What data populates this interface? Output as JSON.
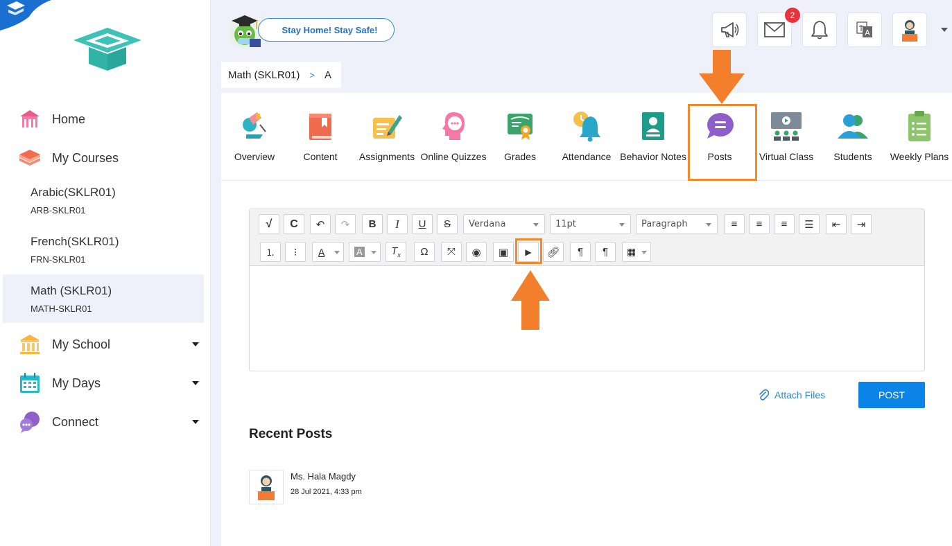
{
  "sidebar": {
    "nav": [
      {
        "label": "Home",
        "icon": "home-icon"
      },
      {
        "label": "My Courses",
        "icon": "courses-icon"
      }
    ],
    "courses": [
      {
        "title": "Arabic(SKLR01)",
        "code": "ARB-SKLR01"
      },
      {
        "title": "French(SKLR01)",
        "code": "FRN-SKLR01"
      },
      {
        "title": "Math (SKLR01)",
        "code": "MATH-SKLR01",
        "active": true
      }
    ],
    "sections": [
      {
        "label": "My School",
        "icon": "school-icon"
      },
      {
        "label": "My Days",
        "icon": "calendar-icon"
      },
      {
        "label": "Connect",
        "icon": "chat-icon"
      }
    ]
  },
  "header": {
    "banner": "Stay Home! Stay Safe!",
    "messages_badge": "2"
  },
  "breadcrumb": {
    "course": "Math (SKLR01)",
    "separator": ">",
    "section": "A"
  },
  "tabs": [
    {
      "label": "Overview",
      "icon": "overview-icon"
    },
    {
      "label": "Content",
      "icon": "book-icon"
    },
    {
      "label": "Assignments",
      "icon": "assignment-icon"
    },
    {
      "label": "Online Quizzes",
      "icon": "quiz-icon"
    },
    {
      "label": "Grades",
      "icon": "certificate-icon"
    },
    {
      "label": "Attendance",
      "icon": "bell-clock-icon"
    },
    {
      "label": "Behavior Notes",
      "icon": "behavior-icon"
    },
    {
      "label": "Posts",
      "icon": "speech-bubble-icon",
      "active": true
    },
    {
      "label": "Virtual Class",
      "icon": "virtual-class-icon"
    },
    {
      "label": "Students",
      "icon": "students-icon"
    },
    {
      "label": "Weekly Plans",
      "icon": "clipboard-icon"
    }
  ],
  "editor": {
    "font": "Verdana",
    "size": "11pt",
    "block": "Paragraph"
  },
  "actions": {
    "attach": "Attach Files",
    "post": "POST"
  },
  "recent": {
    "title": "Recent Posts",
    "posts": [
      {
        "author": "Ms. Hala Magdy",
        "date": "28 Jul 2021, 4:33 pm"
      }
    ]
  },
  "colors": {
    "accent": "#0a84e6",
    "highlight": "#f08a2b",
    "badge": "#e8333c",
    "page_bg": "#eef0fa"
  }
}
